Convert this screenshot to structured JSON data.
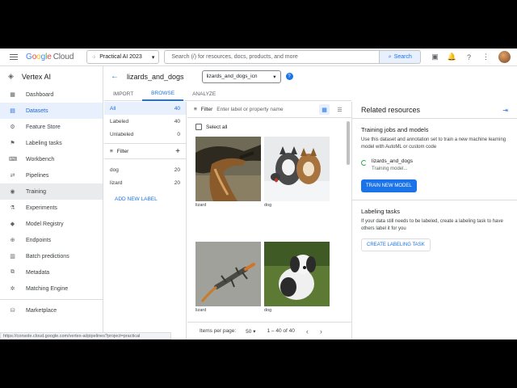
{
  "topbar": {
    "brand": {
      "google": "Google",
      "cloud": "Cloud"
    },
    "project": "Practical AI 2023",
    "search_placeholder": "Search (/) for resources, docs, products, and more",
    "search_button": "Search"
  },
  "sidebar": {
    "product": "Vertex AI",
    "items": [
      {
        "label": "Dashboard",
        "icon": "dashboard-icon"
      },
      {
        "label": "Datasets",
        "icon": "datasets-icon"
      },
      {
        "label": "Feature Store",
        "icon": "feature-store-icon"
      },
      {
        "label": "Labeling tasks",
        "icon": "labeling-icon"
      },
      {
        "label": "Workbench",
        "icon": "workbench-icon"
      },
      {
        "label": "Pipelines",
        "icon": "pipelines-icon"
      },
      {
        "label": "Training",
        "icon": "training-icon"
      },
      {
        "label": "Experiments",
        "icon": "experiments-icon"
      },
      {
        "label": "Model Registry",
        "icon": "model-registry-icon"
      },
      {
        "label": "Endpoints",
        "icon": "endpoints-icon"
      },
      {
        "label": "Batch predictions",
        "icon": "batch-icon"
      },
      {
        "label": "Metadata",
        "icon": "metadata-icon"
      },
      {
        "label": "Matching Engine",
        "icon": "matching-icon"
      }
    ],
    "marketplace": "Marketplace",
    "status_url": "https://console.cloud.google.com/vertex-ai/pipelines?project=practical"
  },
  "dataset": {
    "title": "lizards_and_dogs",
    "selector": "lizards_and_dogs_icn"
  },
  "tabs": [
    "IMPORT",
    "BROWSE",
    "ANALYZE"
  ],
  "labels": {
    "all": {
      "label": "All",
      "count": "40"
    },
    "labeled": {
      "label": "Labeled",
      "count": "40"
    },
    "unlabeled": {
      "label": "Unlabeled",
      "count": "0"
    },
    "filter": "Filter",
    "items": [
      {
        "label": "dog",
        "count": "20"
      },
      {
        "label": "lizard",
        "count": "20"
      }
    ],
    "add": "ADD NEW LABEL"
  },
  "browse": {
    "filter": "Filter",
    "filter_placeholder": "Enter label or property name",
    "select_all": "Select all",
    "images": [
      {
        "label": "lizard"
      },
      {
        "label": "dog"
      },
      {
        "label": "lizard"
      },
      {
        "label": "dog"
      }
    ],
    "items_per_page_label": "Items per page:",
    "items_per_page": "50",
    "range": "1 – 40 of 40"
  },
  "related": {
    "title": "Related resources",
    "training_heading": "Training jobs and models",
    "training_text": "Use this dataset and annotation set to train a new machine learning model with AutoML or custom code",
    "model_name": "lizards_and_dogs",
    "model_status": "Training model...",
    "train_button": "TRAIN NEW MODEL",
    "labeling_heading": "Labeling tasks",
    "labeling_text": "If your data still needs to be labeled, create a labeling task to have others label it for you",
    "labeling_button": "CREATE LABELING TASK"
  }
}
